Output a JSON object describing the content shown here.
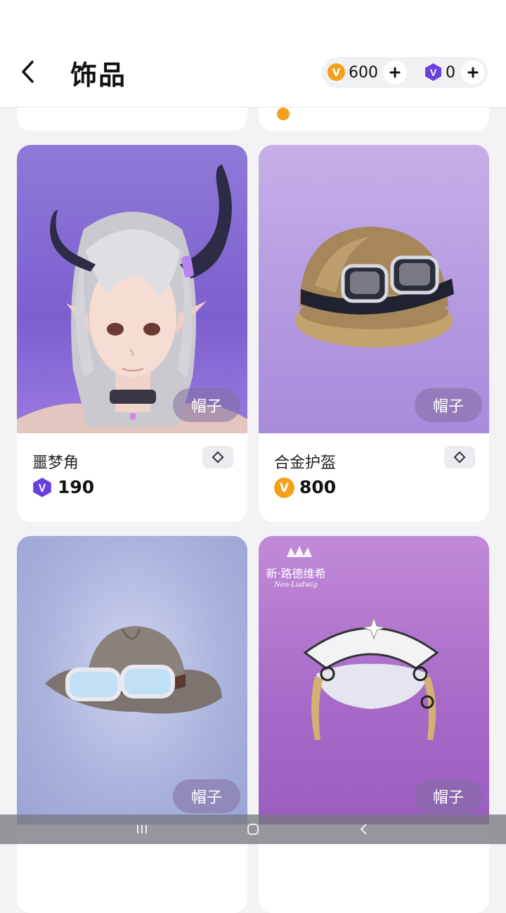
{
  "header": {
    "title": "饰品",
    "coin_balance": "600",
    "vip_balance": "0"
  },
  "cards": [
    {
      "name": "噩梦角",
      "tag": "帽子",
      "currency": "vip",
      "price": "190"
    },
    {
      "name": "合金护盔",
      "tag": "帽子",
      "currency": "coin",
      "price": "800"
    },
    {
      "name": "",
      "tag": "帽子",
      "currency": "coin",
      "price": ""
    },
    {
      "name": "",
      "tag": "帽子",
      "currency": "coin",
      "price": "",
      "watermark": "新·路德维希",
      "watermark_sub": "Neo-Ludwig"
    }
  ],
  "colors": {
    "coin": "#f4a01a",
    "vip": "#6a3fe0",
    "card1_bg": "#8a6fd6",
    "card2_bg": "#b69ae0",
    "card3_bg": "#a7b2dc",
    "card4_bg": "#b07ad0"
  },
  "icons": {
    "back": "chevron-left-icon",
    "coin": "v-coin-icon",
    "vip": "v-hexagon-icon",
    "plus": "plus-icon",
    "tryon": "diamond-outline-icon"
  }
}
